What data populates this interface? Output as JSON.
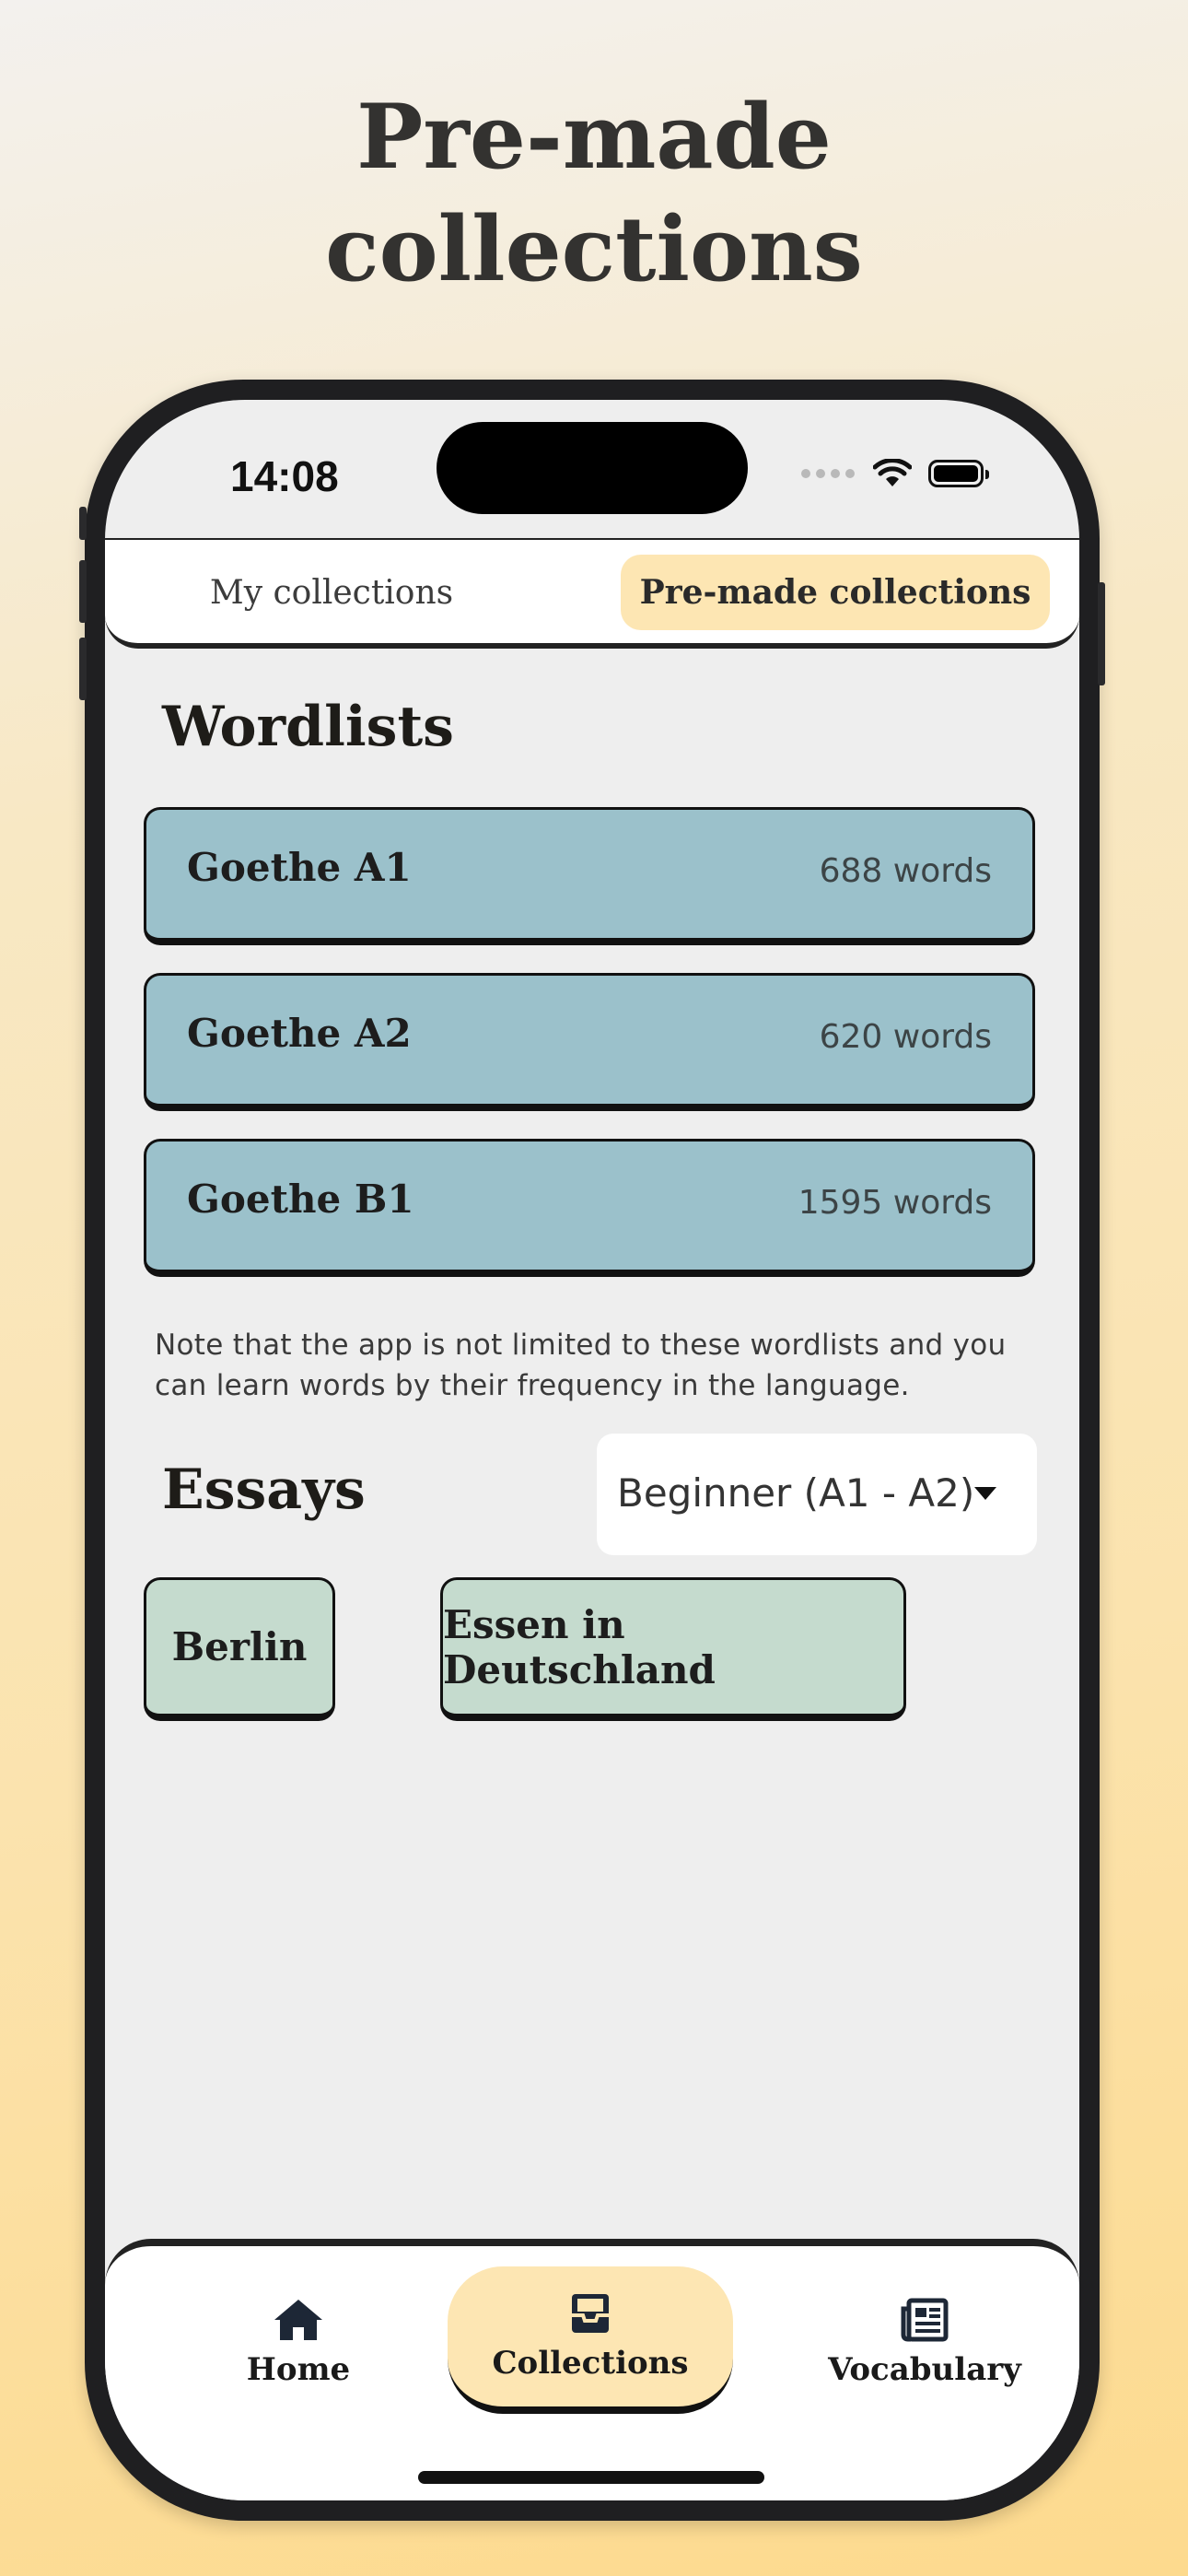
{
  "headline": {
    "line1": "Pre-made",
    "line2": "collections"
  },
  "status_bar": {
    "time": "14:08"
  },
  "tabs": {
    "my": "My collections",
    "premade": "Pre-made collections",
    "active": "premade"
  },
  "wordlists": {
    "title": "Wordlists",
    "items": [
      {
        "name": "Goethe A1",
        "count": "688 words"
      },
      {
        "name": "Goethe A2",
        "count": "620 words"
      },
      {
        "name": "Goethe B1",
        "count": "1595 words"
      }
    ],
    "note": "Note that the app is not limited to these wordlists and you can learn words by their frequency in the language."
  },
  "essays": {
    "title": "Essays",
    "level_selected": "Beginner (A1 - A2)",
    "items": [
      "Berlin",
      "Essen in Deutschland"
    ]
  },
  "bottom_nav": {
    "home": "Home",
    "collections": "Collections",
    "vocabulary": "Vocabulary",
    "active": "collections"
  },
  "colors": {
    "accent": "#fde6b3",
    "wordlist_card": "#9bc1cb",
    "essay_card": "#c5dbce",
    "screen_bg": "#eeeeee"
  }
}
